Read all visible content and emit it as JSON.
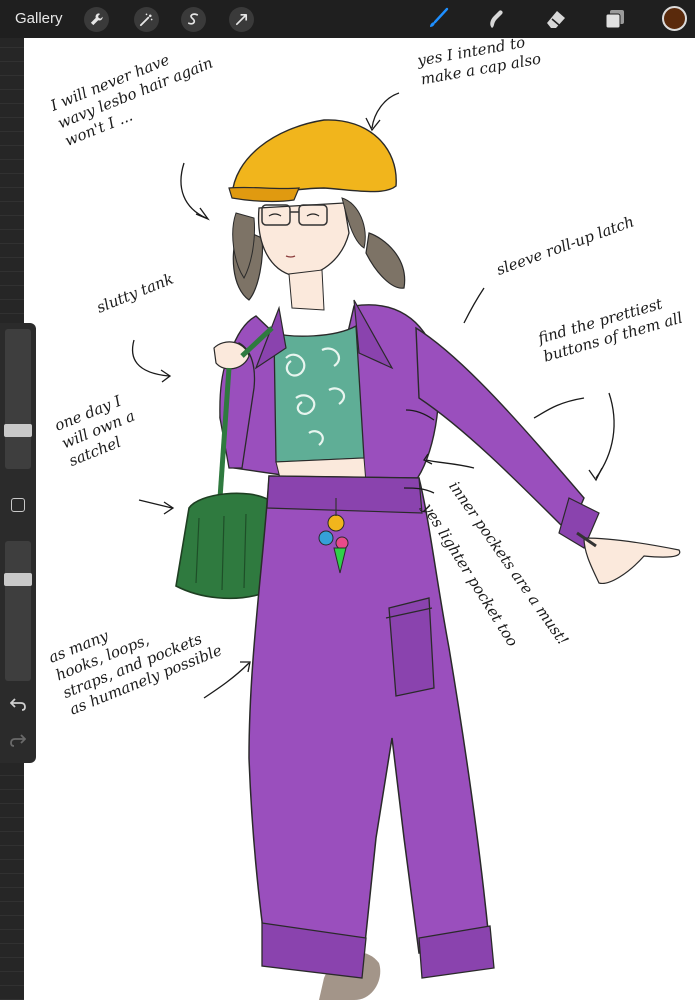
{
  "toolbar": {
    "gallery_label": "Gallery",
    "left_tools": [
      "wrench-icon",
      "magic-wand-icon",
      "selection-s-icon",
      "transform-arrow-icon"
    ],
    "right_tools": [
      "brush-icon",
      "smudge-icon",
      "eraser-icon",
      "layers-icon"
    ],
    "active_tool": "brush-icon",
    "current_color": "#5a2a0c"
  },
  "sidebar": {
    "brush_size_level": 0.25,
    "opacity_level": 0.75,
    "modify_button": "square-icon",
    "undo": "undo-icon",
    "redo": "redo-icon"
  },
  "colors": {
    "hat": "#f1b51c",
    "outfit": "#9a4fbd",
    "tank": "#5fae96",
    "bag": "#2f7a3f",
    "hair": "#7d7366"
  },
  "notes": {
    "cap": [
      "yes I intend to",
      "make a cap also"
    ],
    "hair": [
      "I will never have",
      "wavy lesbo hair again",
      "won't I ..."
    ],
    "sleeve": [
      "sleeve roll-up latch"
    ],
    "buttons": [
      "find the prettiest",
      "buttons of them all"
    ],
    "tank": [
      "slutty tank"
    ],
    "satchel": [
      "one day I",
      "will own a",
      "satchel"
    ],
    "pockets": [
      "inner pockets are a must!"
    ],
    "lighter": [
      "yes lighter pocket too"
    ],
    "hooks": [
      "as many",
      "hooks, loops,",
      "straps, and pockets",
      "as humanely possible"
    ]
  }
}
